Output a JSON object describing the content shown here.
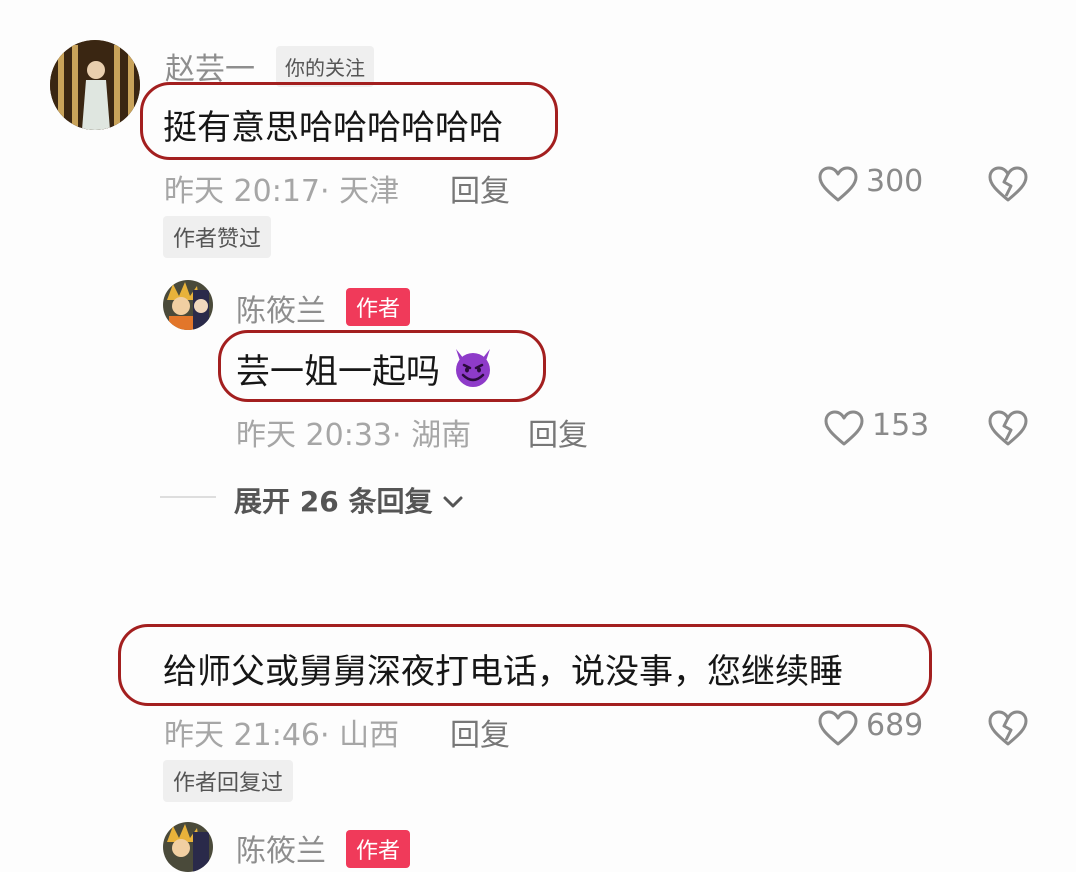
{
  "comments": [
    {
      "user": "赵芸一",
      "follow_tag": "你的关注",
      "text": "挺有意思哈哈哈哈哈哈",
      "time_location": "昨天 20:17· 天津",
      "reply_label": "回复",
      "likes": "300",
      "badge": "作者赞过",
      "replies": [
        {
          "user": "陈筱兰",
          "author_tag": "作者",
          "text": "芸一姐一起吗",
          "emoji": "😈",
          "time_location": "昨天 20:33· 湖南",
          "reply_label": "回复",
          "likes": "153"
        }
      ],
      "expand_label": "展开 26 条回复"
    },
    {
      "text": "给师父或舅舅深夜打电话，说没事，您继续睡",
      "time_location": "昨天 21:46· 山西",
      "reply_label": "回复",
      "likes": "689",
      "badge": "作者回复过",
      "partial_reply": {
        "user": "陈筱兰",
        "author_tag": "作者"
      }
    }
  ],
  "colors": {
    "highlight_border": "#a31f1f",
    "author_tag": "#f03a5a"
  },
  "icons": [
    "heart-outline-icon",
    "broken-heart-icon",
    "chevron-down-icon"
  ]
}
